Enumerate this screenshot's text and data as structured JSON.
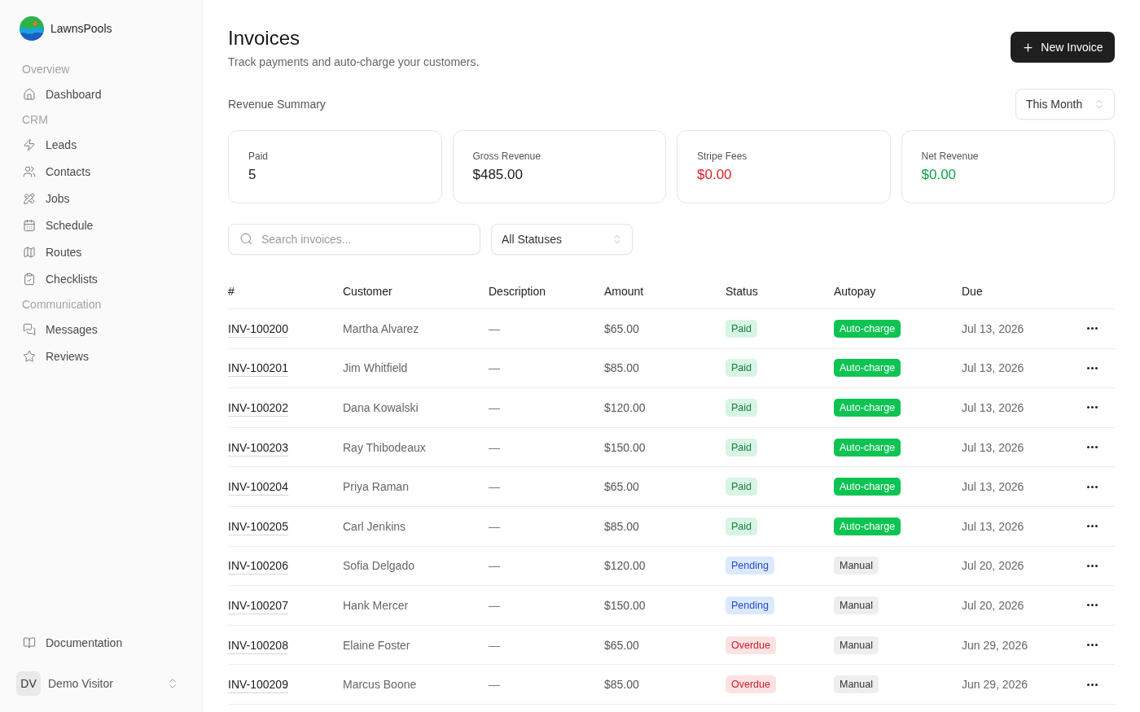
{
  "sidebar": {
    "brand": "LawnsPools",
    "sections": [
      {
        "label": "Overview",
        "items": [
          {
            "label": "Dashboard"
          }
        ]
      },
      {
        "label": "CRM",
        "items": [
          {
            "label": "Leads"
          },
          {
            "label": "Contacts"
          },
          {
            "label": "Jobs"
          },
          {
            "label": "Schedule"
          },
          {
            "label": "Routes"
          },
          {
            "label": "Checklists"
          }
        ]
      },
      {
        "label": "Communication",
        "items": [
          {
            "label": "Messages"
          },
          {
            "label": "Reviews"
          }
        ]
      }
    ],
    "footer_links": [
      {
        "label": "Documentation"
      }
    ],
    "user": {
      "initials": "DV",
      "name": "Demo Visitor"
    }
  },
  "header": {
    "title": "Invoices",
    "subtitle": "Track payments and auto-charge your customers.",
    "primary_button": "New Invoice"
  },
  "summary": {
    "title": "Revenue Summary",
    "period": "This Month",
    "cards": [
      {
        "label": "Paid",
        "value": "5",
        "kind": "neutral"
      },
      {
        "label": "Gross Revenue",
        "value": "$485.00",
        "kind": "neutral"
      },
      {
        "label": "Stripe Fees",
        "value": "$0.00",
        "kind": "negative"
      },
      {
        "label": "Net Revenue",
        "value": "$0.00",
        "kind": "positive"
      }
    ]
  },
  "filters": {
    "search": {
      "placeholder": "Search invoices..."
    },
    "status": "All Statuses"
  },
  "table": {
    "columns": [
      "#",
      "Customer",
      "Description",
      "Amount",
      "Status",
      "Autopay",
      "Due"
    ],
    "rows": [
      {
        "number": "INV-100200",
        "customer": "Martha Alvarez",
        "description": "—",
        "amount": "$65.00",
        "status": {
          "label": "Paid",
          "kind": "paid"
        },
        "autopay": {
          "label": "Auto-charge",
          "kind": "auto"
        },
        "due": "Jul 13, 2026"
      },
      {
        "number": "INV-100201",
        "customer": "Jim Whitfield",
        "description": "—",
        "amount": "$85.00",
        "status": {
          "label": "Paid",
          "kind": "paid"
        },
        "autopay": {
          "label": "Auto-charge",
          "kind": "auto"
        },
        "due": "Jul 13, 2026"
      },
      {
        "number": "INV-100202",
        "customer": "Dana Kowalski",
        "description": "—",
        "amount": "$120.00",
        "status": {
          "label": "Paid",
          "kind": "paid"
        },
        "autopay": {
          "label": "Auto-charge",
          "kind": "auto"
        },
        "due": "Jul 13, 2026"
      },
      {
        "number": "INV-100203",
        "customer": "Ray Thibodeaux",
        "description": "—",
        "amount": "$150.00",
        "status": {
          "label": "Paid",
          "kind": "paid"
        },
        "autopay": {
          "label": "Auto-charge",
          "kind": "auto"
        },
        "due": "Jul 13, 2026"
      },
      {
        "number": "INV-100204",
        "customer": "Priya Raman",
        "description": "—",
        "amount": "$65.00",
        "status": {
          "label": "Paid",
          "kind": "paid"
        },
        "autopay": {
          "label": "Auto-charge",
          "kind": "auto"
        },
        "due": "Jul 13, 2026"
      },
      {
        "number": "INV-100205",
        "customer": "Carl Jenkins",
        "description": "—",
        "amount": "$85.00",
        "status": {
          "label": "Paid",
          "kind": "paid"
        },
        "autopay": {
          "label": "Auto-charge",
          "kind": "auto"
        },
        "due": "Jul 13, 2026"
      },
      {
        "number": "INV-100206",
        "customer": "Sofia Delgado",
        "description": "—",
        "amount": "$120.00",
        "status": {
          "label": "Pending",
          "kind": "pending"
        },
        "autopay": {
          "label": "Manual",
          "kind": "manual"
        },
        "due": "Jul 20, 2026"
      },
      {
        "number": "INV-100207",
        "customer": "Hank Mercer",
        "description": "—",
        "amount": "$150.00",
        "status": {
          "label": "Pending",
          "kind": "pending"
        },
        "autopay": {
          "label": "Manual",
          "kind": "manual"
        },
        "due": "Jul 20, 2026"
      },
      {
        "number": "INV-100208",
        "customer": "Elaine Foster",
        "description": "—",
        "amount": "$65.00",
        "status": {
          "label": "Overdue",
          "kind": "overdue"
        },
        "autopay": {
          "label": "Manual",
          "kind": "manual"
        },
        "due": "Jun 29, 2026"
      },
      {
        "number": "INV-100209",
        "customer": "Marcus Boone",
        "description": "—",
        "amount": "$85.00",
        "status": {
          "label": "Overdue",
          "kind": "overdue"
        },
        "autopay": {
          "label": "Manual",
          "kind": "manual"
        },
        "due": "Jun 29, 2026"
      }
    ]
  }
}
